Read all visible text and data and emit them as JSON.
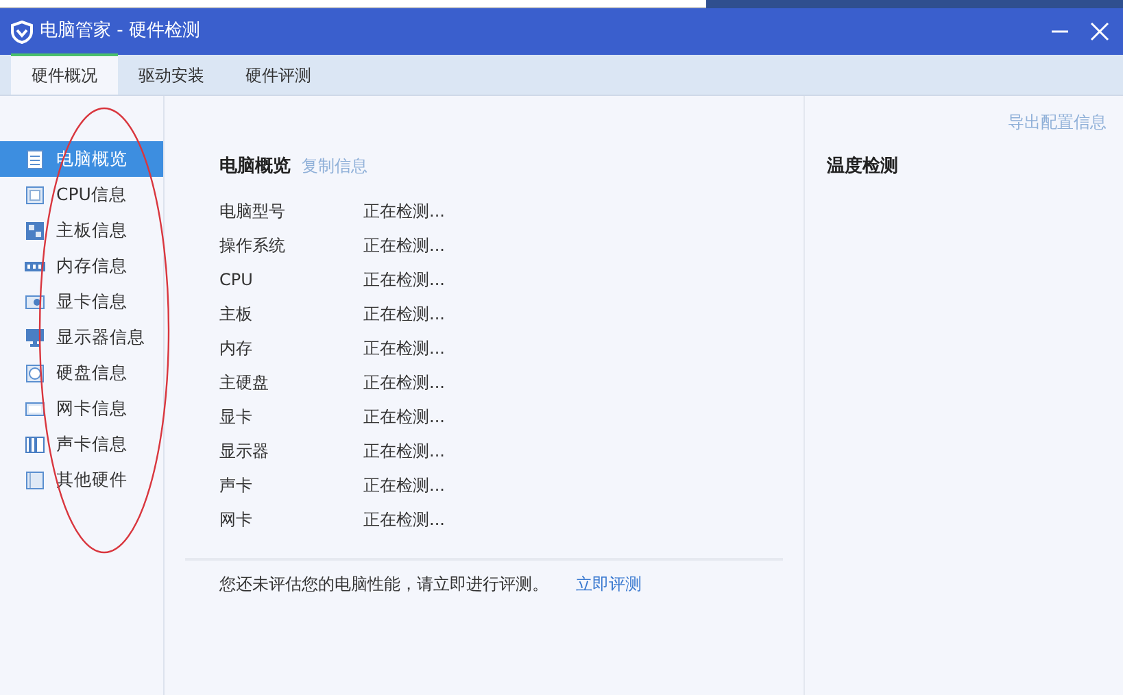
{
  "window": {
    "title": "电脑管家 - 硬件检测"
  },
  "tabs": [
    {
      "label": "硬件概况",
      "selected": true
    },
    {
      "label": "驱动安装",
      "selected": false
    },
    {
      "label": "硬件评测",
      "selected": false
    }
  ],
  "export_link": "导出配置信息",
  "sidebar": {
    "items": [
      {
        "label": "电脑概览",
        "selected": true
      },
      {
        "label": "CPU信息",
        "selected": false
      },
      {
        "label": "主板信息",
        "selected": false
      },
      {
        "label": "内存信息",
        "selected": false
      },
      {
        "label": "显卡信息",
        "selected": false
      },
      {
        "label": "显示器信息",
        "selected": false
      },
      {
        "label": "硬盘信息",
        "selected": false
      },
      {
        "label": "网卡信息",
        "selected": false
      },
      {
        "label": "声卡信息",
        "selected": false
      },
      {
        "label": "其他硬件",
        "selected": false
      }
    ]
  },
  "overview": {
    "title": "电脑概览",
    "copy_link": "复制信息",
    "rows": [
      {
        "label": "电脑型号",
        "value": "正在检测..."
      },
      {
        "label": "操作系统",
        "value": "正在检测..."
      },
      {
        "label": "CPU",
        "value": "正在检测..."
      },
      {
        "label": "主板",
        "value": "正在检测..."
      },
      {
        "label": "内存",
        "value": "正在检测..."
      },
      {
        "label": "主硬盘",
        "value": "正在检测..."
      },
      {
        "label": "显卡",
        "value": "正在检测..."
      },
      {
        "label": "显示器",
        "value": "正在检测..."
      },
      {
        "label": "声卡",
        "value": "正在检测..."
      },
      {
        "label": "网卡",
        "value": "正在检测..."
      }
    ],
    "notice": "您还未评估您的电脑性能，请立即进行评测。",
    "notice_link": "立即评测"
  },
  "temperature": {
    "title": "温度检测"
  }
}
